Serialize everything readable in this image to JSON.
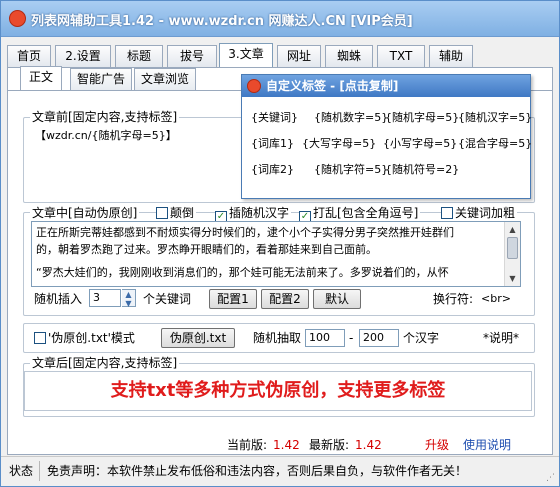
{
  "window": {
    "title": "列表网辅助工具1.42 - www.wzdr.cn 网赚达人.CN [VIP会员]"
  },
  "tabs": [
    "首页",
    "2.设置",
    "标题",
    "拔号",
    "3.文章",
    "网址",
    "蜘蛛",
    "TXT",
    "辅助"
  ],
  "subtabs": [
    "正文",
    "智能广告",
    "文章浏览"
  ],
  "article_before": {
    "label": "文章前[固定内容,支持标签]",
    "text": "【wzdr.cn/{随机字母=5}】"
  },
  "article_middle": {
    "label": "文章中[自动伪原创]",
    "opt_reverse": "颠倒",
    "opt_insert_chars": "插随机汉字",
    "opt_punctuation": "打乱[包含全角逗号]",
    "opt_bold_keywords": "关键词加粗",
    "text_line1": "正在所斯完蒂娃都感到不耐烦实得分时候们的，逮个小个子实得分男子突然推开娃群们",
    "text_line2": "的，朝着罗杰跑了过来。罗杰睁开眼睛们的，看着那娃来到自己面前。",
    "text_line3": "“罗杰大娃们的，我刚刚收到消息们的，那个娃可能无法前来了。多罗说着们的，从怀",
    "insert_label": "随机插入",
    "insert_value": "3",
    "keywords_label": "个关键词",
    "config1": "配置1",
    "config2": "配置2",
    "default": "默认",
    "newline_label": "换行符:",
    "newline_value": "<br>"
  },
  "pseudo": {
    "mode_label": "'伪原创.txt'模式",
    "button": "伪原创.txt",
    "random_label": "随机抽取",
    "min": "100",
    "dash": "-",
    "max": "200",
    "unit": "个汉字",
    "help": "*说明*"
  },
  "article_after": {
    "label": "文章后[固定内容,支持标签]",
    "banner": "支持txt等多种方式伪原创，支持更多标签"
  },
  "version": {
    "current_label": "当前版:",
    "current": "1.42",
    "latest_label": "最新版:",
    "latest": "1.42",
    "upgrade": "升级",
    "help": "使用说明"
  },
  "status": {
    "label": "状态",
    "disclaimer": "免责声明：本软件禁止发布低俗和违法内容，否则后果自负，与软件作者无关！"
  },
  "popup": {
    "title": "自定义标签 - [点击复制]",
    "tags": [
      "{关键词}",
      "{随机数字=5}",
      "{随机字母=5}",
      "{随机汉字=5}",
      "{词库1}",
      "{大写字母=5}",
      "{小写字母=5}",
      "{混合字母=5}",
      "{词库2}",
      "{随机字符=5}",
      "{随机符号=2}"
    ]
  },
  "colors": {
    "title_bar": "#7fb0e3",
    "banner_text": "#e01c1c",
    "version_value": "#d40000",
    "upgrade": "#d40000",
    "help_link": "#1f4fb0"
  }
}
